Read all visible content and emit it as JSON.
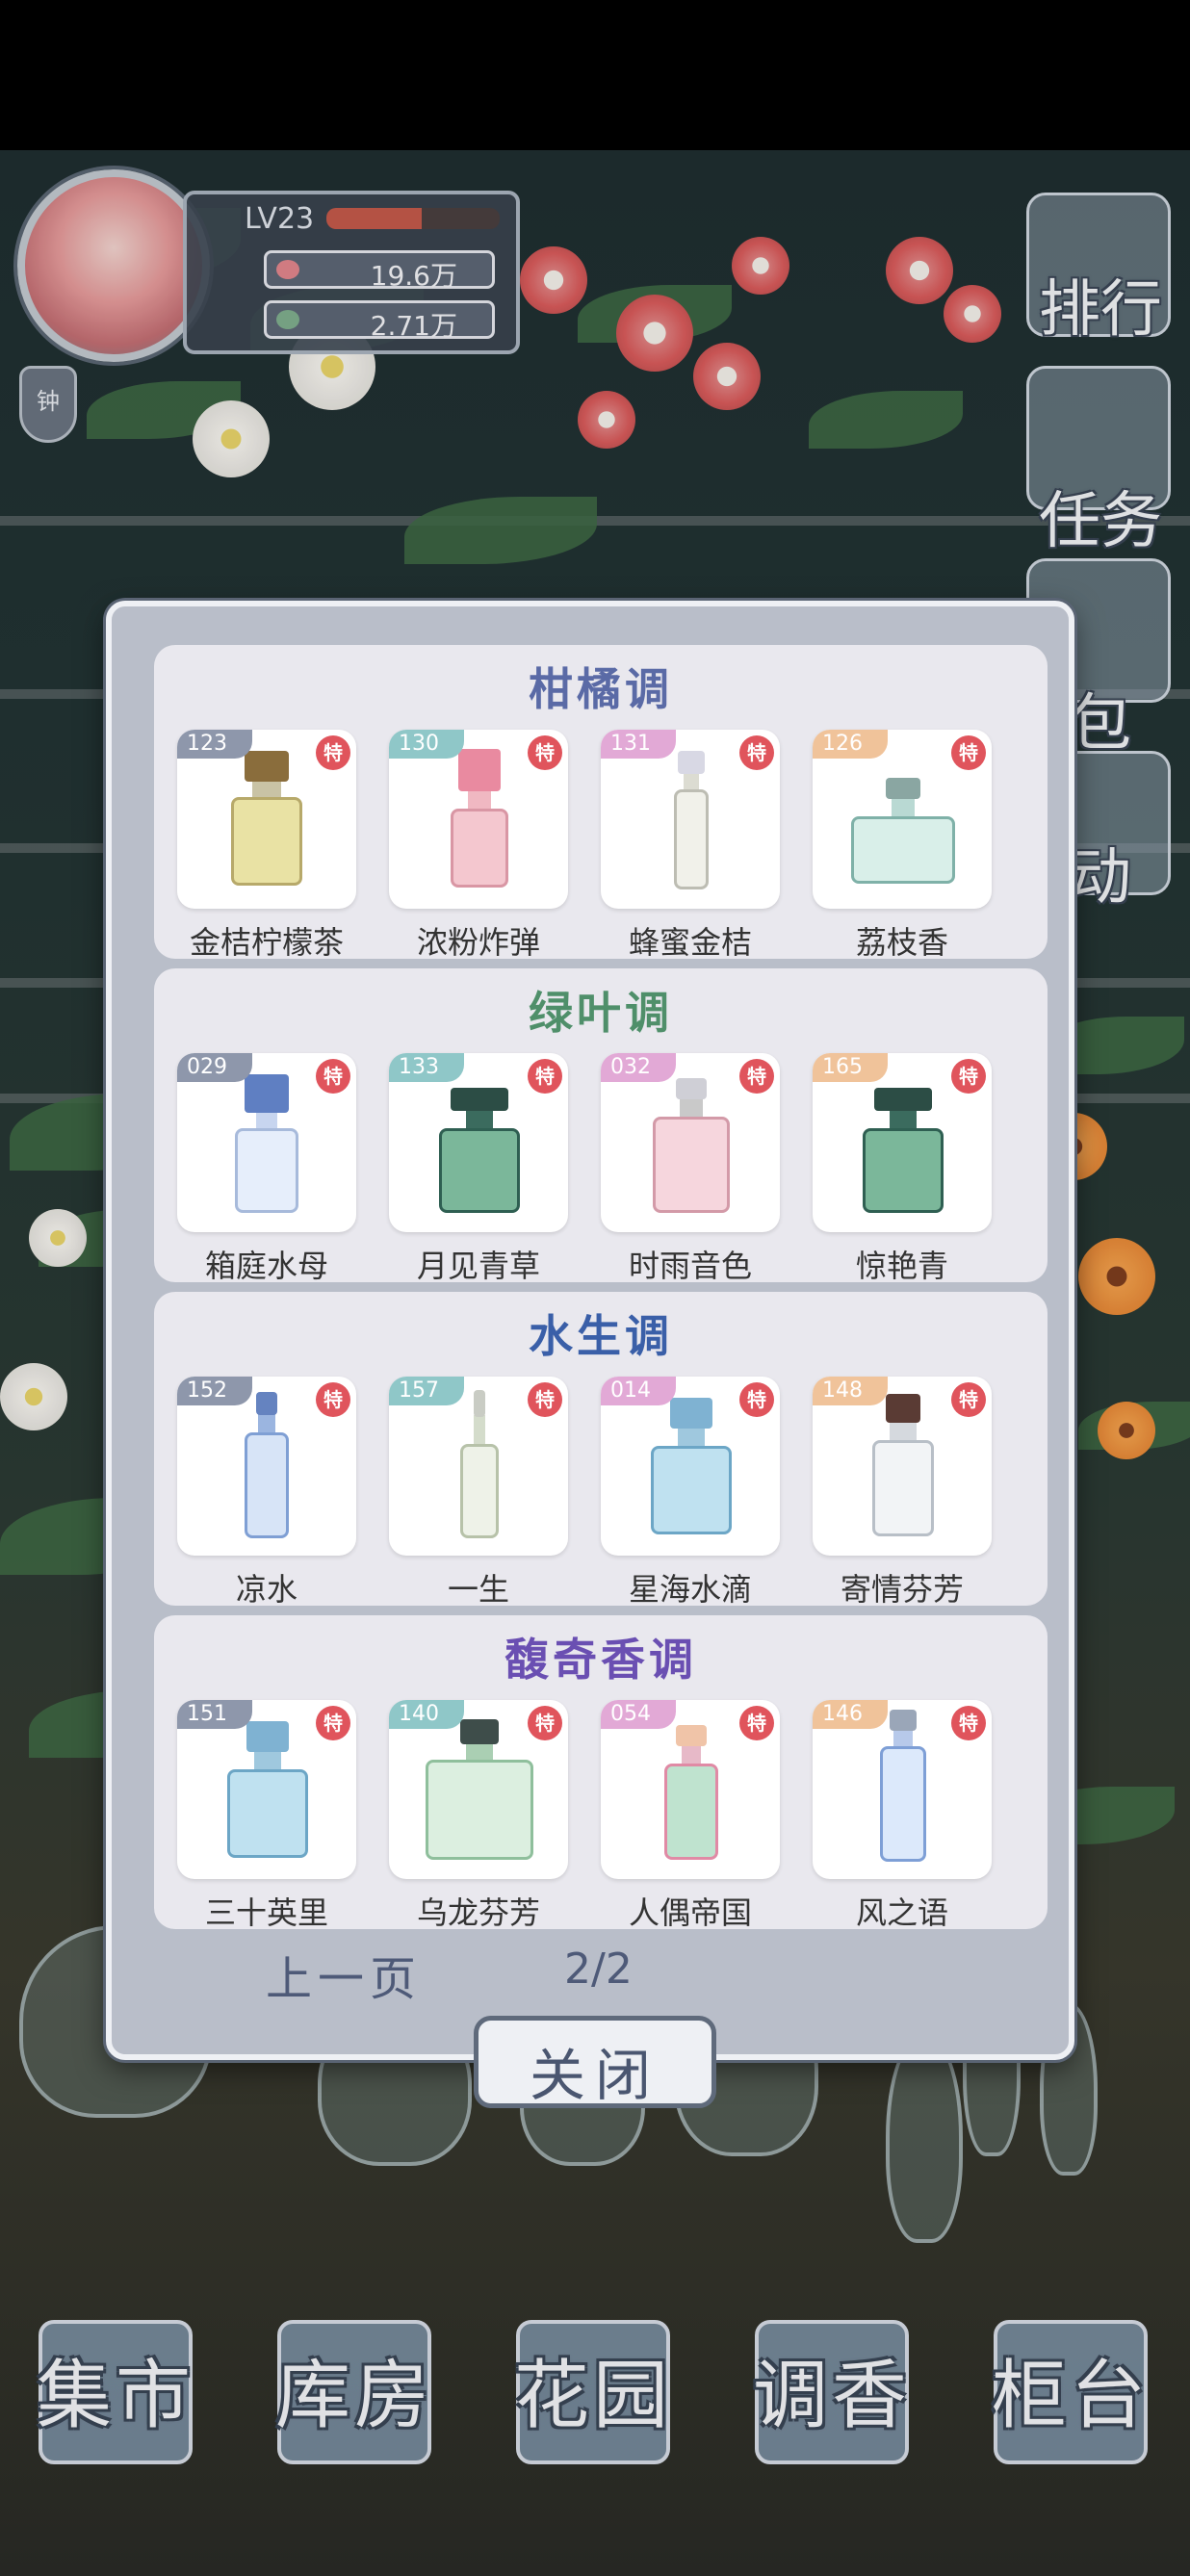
{
  "profile": {
    "level": "LV23",
    "exp_progress": 0.55,
    "currency_1": "19.6万",
    "currency_2": "2.71万",
    "bell_label": "钟"
  },
  "side_menu": [
    "排行",
    "任务",
    "包",
    "动"
  ],
  "modal": {
    "sections": [
      {
        "title": "柑橘调",
        "title_color": "#5a6aa6",
        "items": [
          {
            "num": "123",
            "tag_color": "#8e97ab",
            "name": "金桔柠檬茶",
            "special": "特",
            "bottle": "square-gold"
          },
          {
            "num": "130",
            "tag_color": "#8fc7c8",
            "name": "浓粉炸弹",
            "special": "特",
            "bottle": "pink-bunny"
          },
          {
            "num": "131",
            "tag_color": "#e2a9d6",
            "name": "蜂蜜金桔",
            "special": "特",
            "bottle": "slim-clear"
          },
          {
            "num": "126",
            "tag_color": "#f0c39a",
            "name": "荔枝香",
            "special": "特",
            "bottle": "round-teal"
          }
        ]
      },
      {
        "title": "绿叶调",
        "title_color": "#4f8f6a",
        "items": [
          {
            "num": "029",
            "tag_color": "#8e97ab",
            "name": "箱庭水母",
            "special": "特",
            "bottle": "blue-flower"
          },
          {
            "num": "133",
            "tag_color": "#8fc7c8",
            "name": "月见青草",
            "special": "特",
            "bottle": "square-green"
          },
          {
            "num": "032",
            "tag_color": "#e2a9d6",
            "name": "时雨音色",
            "special": "特",
            "bottle": "square-pink"
          },
          {
            "num": "165",
            "tag_color": "#f0c39a",
            "name": "惊艳青",
            "special": "特",
            "bottle": "square-green"
          }
        ]
      },
      {
        "title": "水生调",
        "title_color": "#3a5fa8",
        "items": [
          {
            "num": "152",
            "tag_color": "#8e97ab",
            "name": "凉水",
            "special": "特",
            "bottle": "blue-tall"
          },
          {
            "num": "157",
            "tag_color": "#8fc7c8",
            "name": "一生",
            "special": "特",
            "bottle": "cone"
          },
          {
            "num": "014",
            "tag_color": "#e2a9d6",
            "name": "星海水滴",
            "special": "特",
            "bottle": "blue-square"
          },
          {
            "num": "148",
            "tag_color": "#f0c39a",
            "name": "寄情芬芳",
            "special": "特",
            "bottle": "clear-slim"
          }
        ]
      },
      {
        "title": "馥奇香调",
        "title_color": "#6a4fb2",
        "items": [
          {
            "num": "151",
            "tag_color": "#8e97ab",
            "name": "三十英里",
            "special": "特",
            "bottle": "blue-square"
          },
          {
            "num": "140",
            "tag_color": "#8fc7c8",
            "name": "乌龙芬芳",
            "special": "特",
            "bottle": "round-green"
          },
          {
            "num": "054",
            "tag_color": "#e2a9d6",
            "name": "人偶帝国",
            "special": "特",
            "bottle": "slim-gradient"
          },
          {
            "num": "146",
            "tag_color": "#f0c39a",
            "name": "风之语",
            "special": "特",
            "bottle": "tall-blue"
          }
        ]
      }
    ],
    "prev_label": "上一页",
    "page": "2/2"
  },
  "close_label": "关闭",
  "bottom_nav": [
    "集市",
    "库房",
    "花园",
    "调香",
    "柜台"
  ]
}
